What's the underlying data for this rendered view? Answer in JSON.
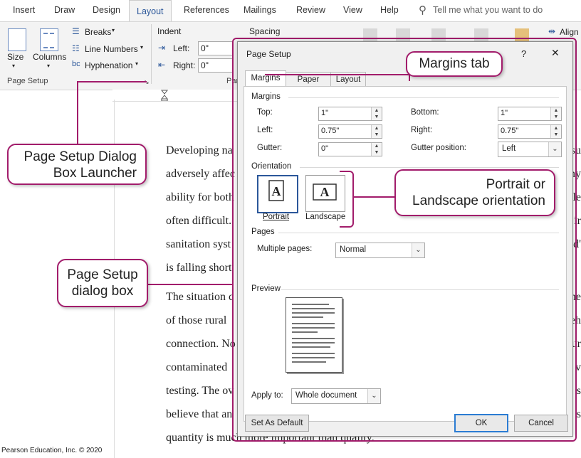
{
  "ribbon_tabs": [
    "Insert",
    "Draw",
    "Design",
    "Layout",
    "References",
    "Mailings",
    "Review",
    "View",
    "Help"
  ],
  "tell_me": "Tell me what you want to do",
  "ribbon": {
    "size": "Size",
    "columns": "Columns",
    "breaks": "Breaks",
    "line_numbers": "Line Numbers",
    "hyphenation": "Hyphenation",
    "page_setup_group": "Page Setup",
    "indent": "Indent",
    "indent_left_label": "Left:",
    "indent_left_value": "0\"",
    "indent_right_label": "Right:",
    "indent_right_value": "0\"",
    "spacing": "Spacing",
    "paragraph_group_partial": "Para",
    "align": "Align"
  },
  "document_lines": [
    {
      "left": "Developing na",
      "right": "su"
    },
    {
      "left": "adversely affec",
      "right": "ny"
    },
    {
      "left": "ability for both",
      "right": "le"
    },
    {
      "left": "often difficult.",
      "right": "ir"
    },
    {
      "left": "sanitation syst",
      "right": "d'"
    },
    {
      "left": "is falling short",
      "right": ""
    },
    {
      "left": "The situation c",
      "right": "he"
    },
    {
      "left": "of those rural",
      "right": "eh"
    },
    {
      "left": "connection. No",
      "right": "ur"
    },
    {
      "left": "contaminated",
      "right": "v"
    },
    {
      "left": "testing. The ov",
      "right": "s"
    },
    {
      "left": "believe that an",
      "right": "s"
    },
    {
      "left": "quantity is much more important than quality.",
      "right": ""
    }
  ],
  "dialog": {
    "title": "Page Setup",
    "help": "?",
    "close": "✕",
    "tabs": [
      "Margins",
      "Paper",
      "Layout"
    ],
    "margins_section": "Margins",
    "top_label": "Top:",
    "top_value": "1\"",
    "bottom_label": "Bottom:",
    "bottom_value": "1\"",
    "left_label": "Left:",
    "left_value": "0.75\"",
    "right_label": "Right:",
    "right_value": "0.75\"",
    "gutter_label": "Gutter:",
    "gutter_value": "0\"",
    "gutter_position_label": "Gutter position:",
    "gutter_position_value": "Left",
    "orientation_section": "Orientation",
    "portrait": "Portrait",
    "landscape": "Landscape",
    "pages_section": "Pages",
    "multiple_pages_label": "Multiple pages:",
    "multiple_pages_value": "Normal",
    "preview_section": "Preview",
    "apply_to_label": "Apply to:",
    "apply_to_value": "Whole document",
    "set_default": "Set As Default",
    "ok": "OK",
    "cancel": "Cancel"
  },
  "callouts": {
    "margins_tab": "Margins tab",
    "launcher_line1": "Page Setup Dialog",
    "launcher_line2": "Box Launcher",
    "orientation_line1": "Portrait or",
    "orientation_line2": "Landscape orientation",
    "dialog_line1": "Page Setup",
    "dialog_line2": "dialog box"
  },
  "credit": "Pearson Education, Inc. © 2020",
  "colors": {
    "callout_border": "#a21c6b",
    "accent": "#2b579a"
  }
}
